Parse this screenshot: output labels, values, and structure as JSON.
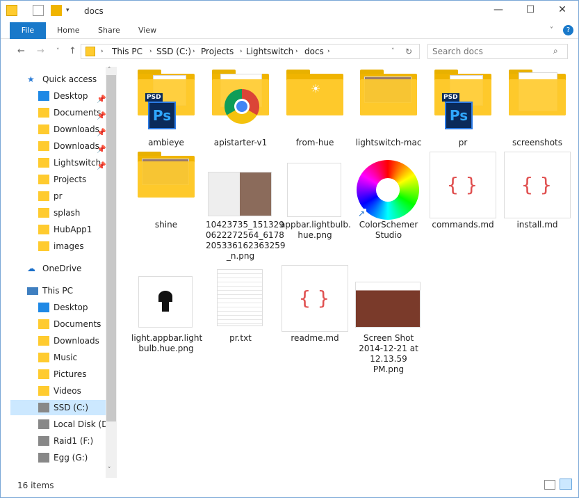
{
  "window": {
    "title": "docs"
  },
  "ribbon": {
    "tabs": [
      "File",
      "Home",
      "Share",
      "View"
    ]
  },
  "address": {
    "crumbs": [
      "This PC",
      "SSD (C:)",
      "Projects",
      "Lightswitch",
      "docs"
    ],
    "search_placeholder": "Search docs"
  },
  "nav": {
    "quick_access": "Quick access",
    "quick_items": [
      "Desktop",
      "Documents",
      "Downloads",
      "Downloads",
      "Lightswitch",
      "Projects",
      "pr",
      "splash",
      "HubApp1",
      "images"
    ],
    "onedrive": "OneDrive",
    "this_pc": "This PC",
    "pc_items": [
      "Desktop",
      "Documents",
      "Downloads",
      "Music",
      "Pictures",
      "Videos",
      "SSD (C:)",
      "Local Disk (D:)",
      "Raid1 (F:)",
      "Egg (G:)"
    ]
  },
  "files": [
    {
      "name": "ambieye",
      "kind": "folder-psd"
    },
    {
      "name": "apistarter-v1",
      "kind": "folder-chrome"
    },
    {
      "name": "from-hue",
      "kind": "folder"
    },
    {
      "name": "lightswitch-mac",
      "kind": "folder-thumbs"
    },
    {
      "name": "pr",
      "kind": "folder-psd2"
    },
    {
      "name": "screenshots",
      "kind": "folder-screens"
    },
    {
      "name": "shine",
      "kind": "folder-thumbs2"
    },
    {
      "name": "10423735_151329\n0622272564_6178\n205336162363259\n_n.png",
      "kind": "image-photo"
    },
    {
      "name": "appbar.lightbulb.\nhue.png",
      "kind": "image-blank"
    },
    {
      "name": "ColorSchemer\nStudio",
      "kind": "shortcut-wheel"
    },
    {
      "name": "commands.md",
      "kind": "md"
    },
    {
      "name": "install.md",
      "kind": "md"
    },
    {
      "name": "light.appbar.light\nbulb.hue.png",
      "kind": "image-bulb"
    },
    {
      "name": "pr.txt",
      "kind": "txt"
    },
    {
      "name": "readme.md",
      "kind": "md"
    },
    {
      "name": "Screen Shot\n2014-12-21 at\n12.13.59 PM.png",
      "kind": "image-screenshot"
    }
  ],
  "status": {
    "count": "16 items"
  }
}
